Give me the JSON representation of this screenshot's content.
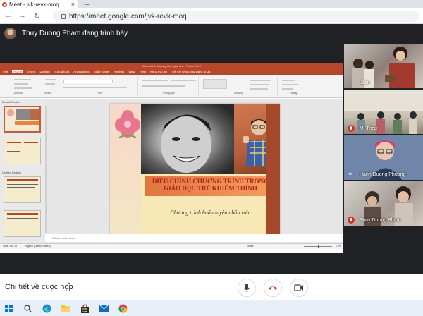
{
  "browser": {
    "tab_title": "Meet - jvk-revk-moq",
    "tab_close": "×",
    "new_tab": "+",
    "back": "←",
    "forward": "→",
    "reload": "↻",
    "url": "https://meet.google.com/jvk-revk-moq"
  },
  "meet": {
    "presenter_label": "Thuy Duong Pham đang trình bày",
    "participants": [
      {
        "name": "Bạn",
        "muted": false
      },
      {
        "name": "Mi Trieu",
        "muted": true
      },
      {
        "name": "Hanh Duong Phuong",
        "muted": false,
        "more": true
      },
      {
        "name": "Thuy Duong Pham",
        "muted": true
      }
    ],
    "details_label": "Chi tiết về cuộc họp",
    "details_chevron": "^"
  },
  "presentation": {
    "window_title": "Dieu chinh chuong trinh giao duc - PowerPoint",
    "ribbon_tabs": [
      "File",
      "Home",
      "Insert",
      "Design",
      "Transitions",
      "Animations",
      "Slide Show",
      "Review",
      "View",
      "Help",
      "Nitro Pro 10",
      "Tell me what you want to do"
    ],
    "ribbon_groups": [
      "Clipboard",
      "Slides",
      "Font",
      "Paragraph",
      "Drawing",
      "Editing"
    ],
    "sections": [
      "Default Section",
      "Untitled Section"
    ],
    "slide_title": "ĐIỀU CHỈNH CHƯƠNG TRÌNH TRONG GIÁO DỤC TRẺ KHIẾM THÍNH",
    "slide_subtitle": "Chương trình huấn luyện nhân viên",
    "notes_placeholder": "Click to add notes",
    "status_left": "Slide 1 of 14",
    "status_language": "English (United States)",
    "status_notes": "Notes",
    "status_zoom": "76%"
  },
  "colors": {
    "ppt_accent": "#b7472a",
    "meet_bg": "#202124",
    "end_call": "#d93025",
    "slide_title": "#b51d1d"
  },
  "taskbar_icons": [
    "windows-icon",
    "search-icon",
    "edge-icon",
    "file-explorer-icon",
    "store-icon",
    "mail-icon",
    "chrome-icon"
  ]
}
